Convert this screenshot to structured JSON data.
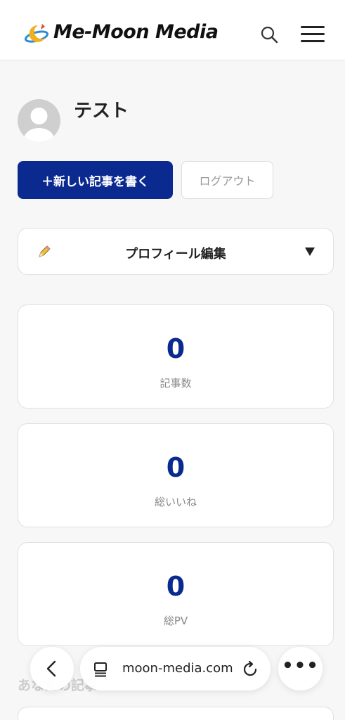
{
  "header": {
    "logo_text": "Me-Moon Media",
    "brand_color": "#0b2a8f",
    "icons": [
      "moon-logo-icon",
      "search-icon",
      "hamburger-menu-icon"
    ]
  },
  "profile": {
    "username": "テスト",
    "new_post_label": "＋新しい記事を書く",
    "logout_label": "ログアウト",
    "edit_label": "プロフィール編集"
  },
  "stats": [
    {
      "value": "0",
      "label": "記事数"
    },
    {
      "value": "0",
      "label": "総いいね"
    },
    {
      "value": "0",
      "label": "総PV"
    }
  ],
  "section": {
    "heading": "あなたの記事"
  },
  "browser": {
    "url": "moon-media.com",
    "icons": [
      "back-icon",
      "tabs-icon",
      "reload-icon",
      "more-icon"
    ]
  }
}
